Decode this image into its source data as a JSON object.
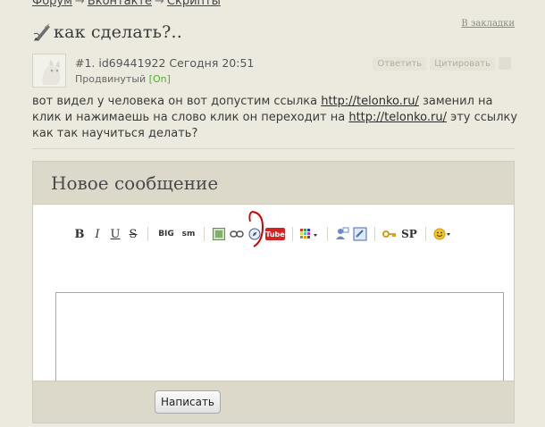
{
  "breadcrumb": {
    "items": [
      "Форум",
      "Вконтакте",
      "Скрипты"
    ],
    "separator": "→"
  },
  "bookmark_label": "В закладки",
  "topic_title": "как сделать?..",
  "post": {
    "number": "#1.",
    "author": "id69441922",
    "time": "Сегодня 20:51",
    "rank": "Продвинутый",
    "status": "[On]",
    "actions": {
      "reply": "Ответить",
      "quote": "Цитировать"
    },
    "body": {
      "part1": "вот видел у человека он вот допустим ссылка ",
      "link1": "http://telonko.ru/",
      "part2": " заменил на клик и нажимаешь на слово клик он переходит на ",
      "link2": "http://telonko.ru/",
      "part3": " эту ссылку как так научиться делать?"
    }
  },
  "reply_form": {
    "title": "Новое сообщение",
    "toolbar": {
      "bold": "B",
      "italic": "I",
      "underline": "U",
      "strike": "S",
      "big": "BIG",
      "small": "sm",
      "youtube": "Tube",
      "spoiler": "SP"
    },
    "textarea_value": "",
    "submit_label": "Написать"
  }
}
